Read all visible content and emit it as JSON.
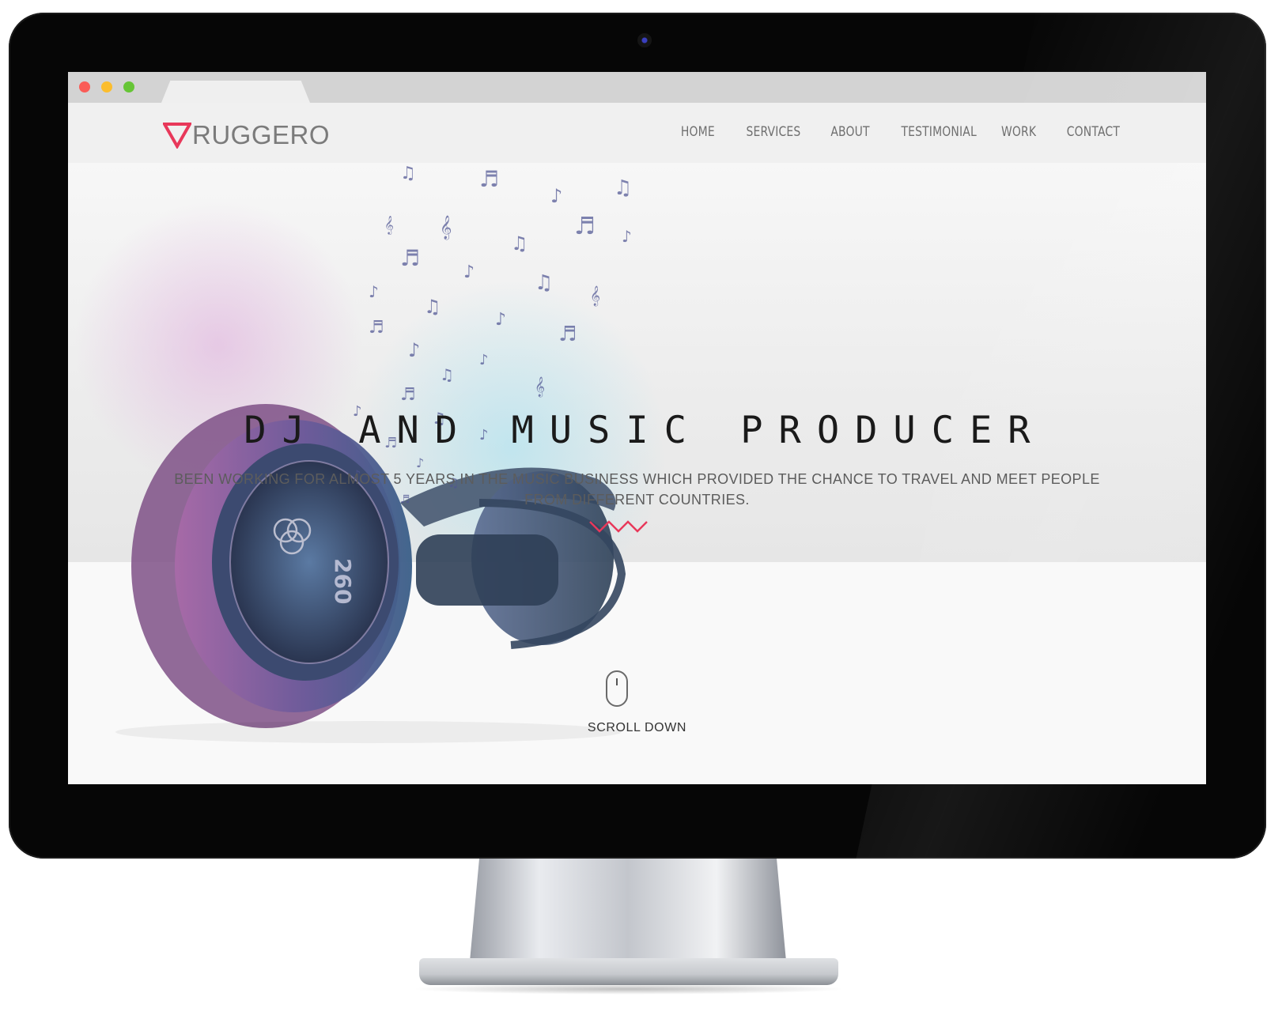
{
  "site": {
    "brand": "RUGGERO",
    "nav": [
      {
        "label": "HOME"
      },
      {
        "label": "SERVICES"
      },
      {
        "label": "ABOUT"
      },
      {
        "label": "TESTIMONIAL"
      },
      {
        "label": "WORK"
      },
      {
        "label": "CONTACT"
      }
    ],
    "hero": {
      "title": "DJ AND MUSIC PRODUCER",
      "subtitle": "BEEN WORKING FOR ALMOST 5 YEARS IN THE MUSIC BUSINESS WHICH PROVIDED THE CHANCE TO TRAVEL AND MEET PEOPLE FROM DIFFERENT COUNTRIES.",
      "headphone_label": "260"
    },
    "scroll": {
      "label": "SCROLL DOWN"
    }
  },
  "icons": {
    "logo_mark": "triangle-down-logo-icon",
    "divider": "zigzag-icon",
    "scroll": "mouse-icon"
  },
  "colors": {
    "accent": "#e8385a",
    "nav_text": "#6f6f6f",
    "title_text": "#1a1a1a",
    "bezel": "#060606"
  }
}
